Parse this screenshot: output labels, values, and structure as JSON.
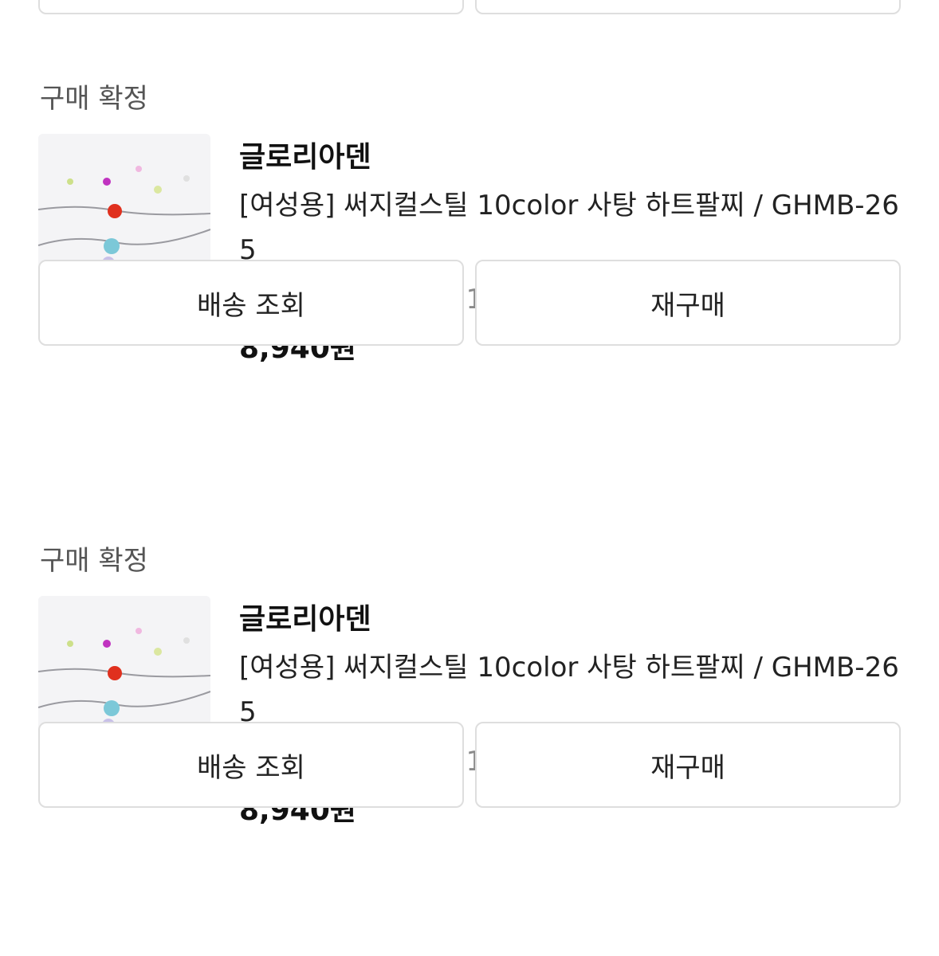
{
  "top_buttons": {
    "left_label": "",
    "right_label": ""
  },
  "orders": [
    {
      "status": "구매 확정",
      "store": "글로리아덴",
      "title": "[여성용] 써지컬스틸 10color 사탕 하트팔찌 / GHMB-265",
      "option": "보라 · 기본사이즈 / 1개",
      "price": "8,940원",
      "buttons": {
        "tracking": "배송 조회",
        "rebuy": "재구매"
      }
    },
    {
      "status": "구매 확정",
      "store": "글로리아덴",
      "title": "[여성용] 써지컬스틸 10color 사탕 하트팔찌 / GHMB-265",
      "option": "레드 · 기본사이즈 / 1개",
      "price": "8,940원",
      "buttons": {
        "tracking": "배송 조회",
        "rebuy": "재구매"
      }
    }
  ],
  "thumbnail": {
    "icon": "heart-bracelet-photo",
    "colors": {
      "red": "#e0301e",
      "teal": "#7cc8d8",
      "lavender": "#c8c0e8",
      "orange": "#f5b24a",
      "magenta": "#c033c0",
      "lime": "#cde08a",
      "pink": "#f0b8e0"
    }
  }
}
